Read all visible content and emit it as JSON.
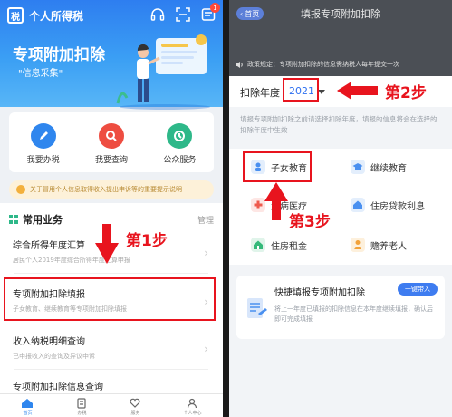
{
  "left": {
    "app_title": "个人所得税",
    "notification_count": "1",
    "hero": {
      "title": "专项附加扣除",
      "subtitle": "\"信息采集\""
    },
    "actions": [
      {
        "label": "我要办税",
        "color": "#2f86ee",
        "icon": "pen-icon"
      },
      {
        "label": "我要查询",
        "color": "#ee4d41",
        "icon": "search-icon"
      },
      {
        "label": "公众服务",
        "color": "#2eb889",
        "icon": "service-icon"
      }
    ],
    "notice": "关于冒用个人信息取得收入提出申诉等的重要提示说明",
    "common": {
      "title": "常用业务",
      "manage": "管理",
      "items": [
        {
          "title": "综合所得年度汇算",
          "desc": "居民个人2019年度综合所得年度汇算申报"
        },
        {
          "title": "专项附加扣除填报",
          "desc": "子女教育、继续教育等专项附加扣除填报"
        },
        {
          "title": "收入纳税明细查询",
          "desc": "已申报收入的查询及异议申诉"
        },
        {
          "title": "专项附加扣除信息查询",
          "desc": ""
        }
      ]
    },
    "tabs": [
      {
        "label": "首页",
        "icon": "home-icon",
        "active": true
      },
      {
        "label": "办税",
        "icon": "doc-icon",
        "active": false
      },
      {
        "label": "服务",
        "icon": "heart-icon",
        "active": false
      },
      {
        "label": "个人中心",
        "icon": "user-icon",
        "active": false
      }
    ],
    "step": "第1步"
  },
  "right": {
    "back_label": "首页",
    "title": "填报专项附加扣除",
    "policy": "政策规定：专项附加扣除的信息需纳税人每年提交一次",
    "year_label": "扣除年度",
    "year_value": "2021",
    "hint": "填报专项附加扣除之前请选择扣除年度，填报的信息将会在选择的扣除年度中生效",
    "items": [
      {
        "label": "子女教育",
        "color": "#4a90f0",
        "icon": "child-icon"
      },
      {
        "label": "继续教育",
        "color": "#4a90f0",
        "icon": "graduation-cap-icon"
      },
      {
        "label": "大病医疗",
        "color": "#ef5a4d",
        "icon": "medical-icon"
      },
      {
        "label": "住房贷款利息",
        "color": "#4a90f0",
        "icon": "house-icon"
      },
      {
        "label": "住房租金",
        "color": "#35b97a",
        "icon": "rent-icon"
      },
      {
        "label": "赡养老人",
        "color": "#f2a23a",
        "icon": "elder-icon"
      }
    ],
    "quick": {
      "title": "快捷填报专项附加扣除",
      "button": "一键带入",
      "desc": "将上一年度已填报的扣除信息在本年度继续填报，确认后即可完成填报"
    },
    "step2": "第2步",
    "step3": "第3步"
  },
  "colors": {
    "accent": "#2d6ff0",
    "highlight": "#e8141e"
  }
}
